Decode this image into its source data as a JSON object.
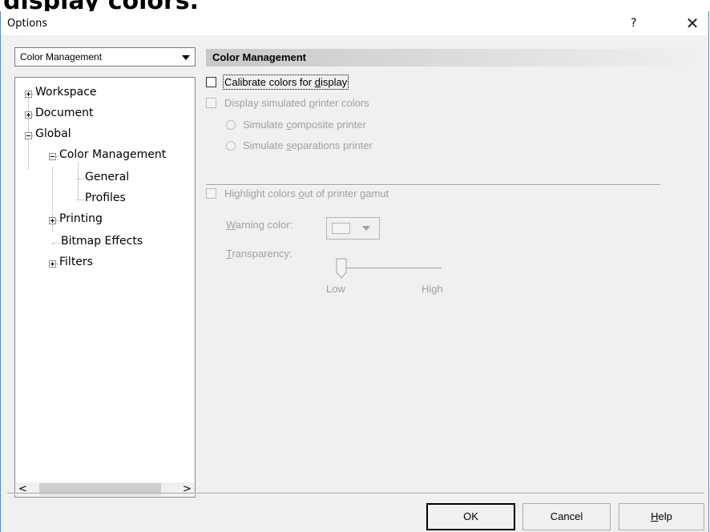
{
  "clipped_top_text": "display colors.",
  "window": {
    "title": "Options",
    "help_button": "?",
    "close_button": "✕"
  },
  "category_combo": {
    "selected": "Color Management"
  },
  "tree": {
    "items": [
      {
        "label": "Workspace"
      },
      {
        "label": "Document"
      },
      {
        "label": "Global"
      },
      {
        "label": "Color Management"
      },
      {
        "label": "General"
      },
      {
        "label": "Profiles"
      },
      {
        "label": "Printing"
      },
      {
        "label": "Bitmap Effects"
      },
      {
        "label": "Filters"
      }
    ],
    "scroll_left": "<",
    "scroll_right": ">"
  },
  "panel": {
    "title": "Color Management",
    "calibrate": {
      "before": "Calibrate colors for ",
      "ul": "d",
      "after": "isplay",
      "checked": false
    },
    "simulate_printer": {
      "before": "Display simulated ",
      "ul": "p",
      "after": "rinter colors",
      "checked": false,
      "enabled": false
    },
    "composite": {
      "before": "Simulate ",
      "ul": "c",
      "after": "omposite printer"
    },
    "separations": {
      "before": "Simulate ",
      "ul": "s",
      "after": "eparations printer"
    },
    "highlight": {
      "before": "Highlight colors ",
      "ul": "o",
      "after": "ut of printer gamut",
      "checked": false,
      "enabled": false
    },
    "warning_color": {
      "ul": "W",
      "after": "arning color:"
    },
    "transparency": {
      "ul": "T",
      "after": "ransparency:",
      "min_label": "Low",
      "max_label": "High",
      "value": 0
    }
  },
  "buttons": {
    "ok": "OK",
    "cancel": "Cancel",
    "help": {
      "ul": "H",
      "after": "elp"
    }
  },
  "colors": {
    "window_border": "#5a8fc4",
    "dialog_bg": "#f0f0f0",
    "disabled_text": "#a0a0a0"
  }
}
